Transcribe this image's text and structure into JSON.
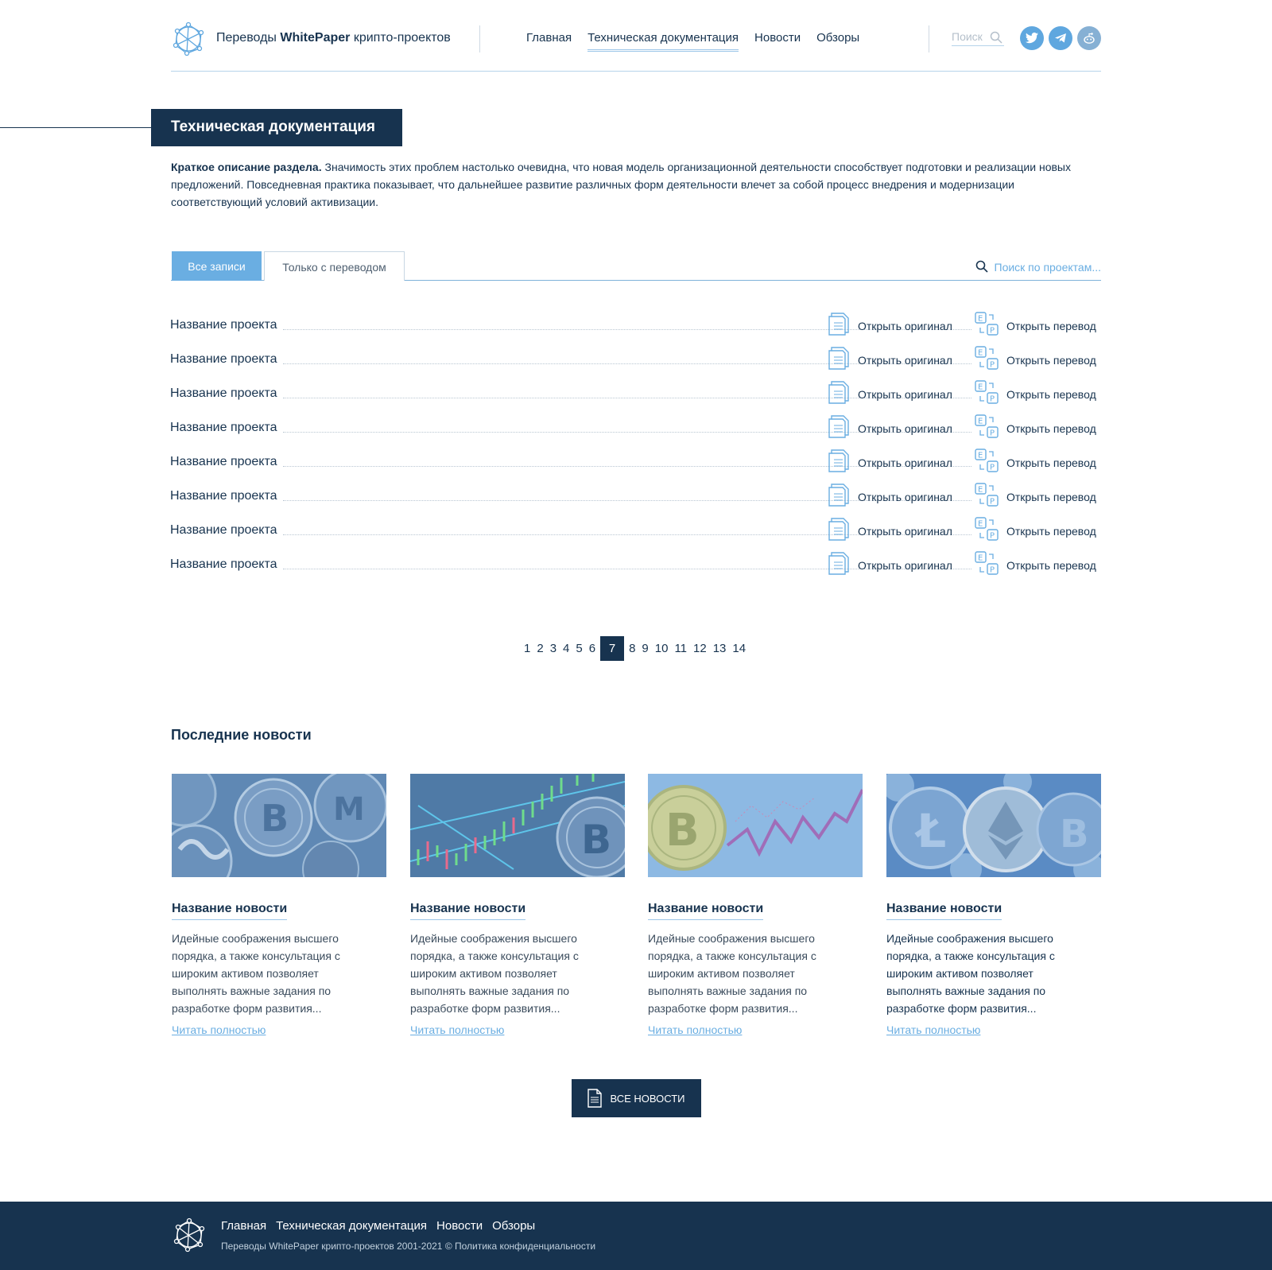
{
  "header": {
    "brand_prefix": "Переводы",
    "brand_bold": "WhitePaper",
    "brand_suffix": "крипто-проектов",
    "nav": [
      "Главная",
      "Техническая документация",
      "Новости",
      "Обзоры"
    ],
    "search_placeholder": "Поиск",
    "social": [
      "twitter-icon",
      "telegram-icon",
      "reddit-icon"
    ]
  },
  "section": {
    "title": "Техническая документация",
    "desc_bold": "Краткое описание раздела.",
    "desc_text": "Значимость этих проблем настолько очевидна, что новая модель организационной деятельности способствует подготовки и реализации новых предложений. Повседневная практика показывает, что дальнейшее развитие различных форм деятельности влечет за собой процесс внедрения и модернизации соответствующий условий активизации."
  },
  "tabs": {
    "all": "Все записи",
    "translated": "Только с переводом",
    "search_placeholder": "Поиск по проектам..."
  },
  "projects": [
    {
      "name": "Название проекта",
      "original": "Открыть оригинал",
      "translation": "Открыть перевод"
    },
    {
      "name": "Название проекта",
      "original": "Открыть оригинал",
      "translation": "Открыть перевод"
    },
    {
      "name": "Название проекта",
      "original": "Открыть оригинал",
      "translation": "Открыть перевод"
    },
    {
      "name": "Название проекта",
      "original": "Открыть оригинал",
      "translation": "Открыть перевод"
    },
    {
      "name": "Название проекта",
      "original": "Открыть оригинал",
      "translation": "Открыть перевод"
    },
    {
      "name": "Название проекта",
      "original": "Открыть оригинал",
      "translation": "Открыть перевод"
    },
    {
      "name": "Название проекта",
      "original": "Открыть оригинал",
      "translation": "Открыть перевод"
    },
    {
      "name": "Название проекта",
      "original": "Открыть оригинал",
      "translation": "Открыть перевод"
    }
  ],
  "pagination": {
    "pages": [
      "1",
      "2",
      "3",
      "4",
      "5",
      "6",
      "7",
      "8",
      "9",
      "10",
      "11",
      "12",
      "13",
      "14"
    ],
    "current": "7"
  },
  "news": {
    "title": "Последние новости",
    "items": [
      {
        "title": "Название новости",
        "text": "Идейные соображения высшего порядка, а также консультация с широким активом позволяет выполнять важные задания по разработке форм развития...",
        "more": "Читать полностью"
      },
      {
        "title": "Название новости",
        "text": "Идейные соображения высшего порядка, а также консультация с широким активом позволяет выполнять важные задания по разработке форм развития...",
        "more": "Читать полностью"
      },
      {
        "title": "Название новости",
        "text": "Идейные соображения высшего порядка, а также консультация с широким активом позволяет выполнять важные задания по разработке форм развития...",
        "more": "Читать полностью"
      },
      {
        "title": "Название новости",
        "text": "Идейные соображения высшего порядка, а также консультация с широким активом позволяет выполнять важные задания по разработке форм развития...",
        "more": "Читать полностью"
      }
    ],
    "all_button": "ВСЕ НОВОСТИ"
  },
  "footer": {
    "nav": [
      "Главная",
      "Техническая документация",
      "Новости",
      "Обзоры"
    ],
    "copyright": "Переводы WhitePaper крипто-проектов 2001-2021 © Политика конфиденциальности"
  },
  "colors": {
    "primary": "#17334f",
    "accent": "#6aaee2",
    "line": "#b6d3ea"
  }
}
